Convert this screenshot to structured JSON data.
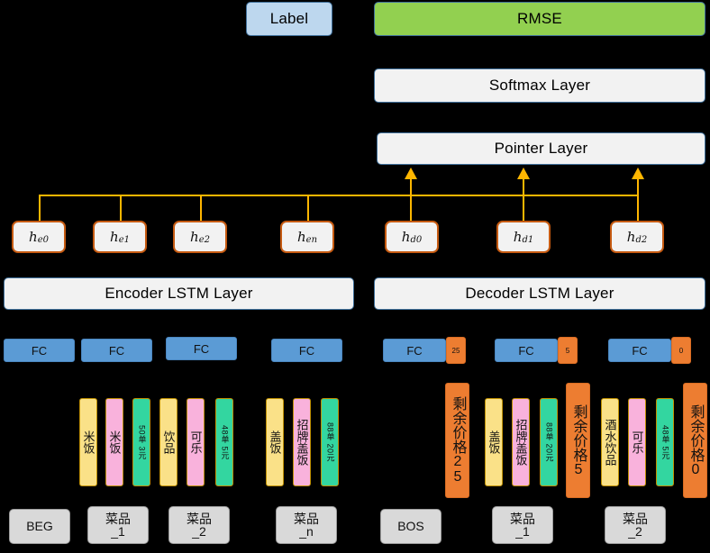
{
  "diagram": {
    "title_boxes": {
      "label": "Label",
      "rmse": "RMSE",
      "softmax": "Softmax Layer",
      "pointer": "Pointer Layer",
      "encoder_lstm": "Encoder LSTM Layer",
      "decoder_lstm": "Decoder LSTM Layer"
    },
    "colors": {
      "rmse_green": "#92D050",
      "label_blue": "#BDD7EE",
      "layer_gray": "#F2F2F2",
      "layer_border": "#41719C",
      "hidden_border": "#C55A11",
      "fc_blue": "#5B9BD5",
      "badge_orange": "#ED7D31",
      "chip_yellow": "#FAE188",
      "chip_pink": "#F9B2DC",
      "chip_green": "#33D6A0",
      "connector_orange": "#FFB600",
      "token_gray": "#D9D9D9",
      "background": "#000000"
    },
    "hidden_states": [
      {
        "base": "h",
        "sub": "e0"
      },
      {
        "base": "h",
        "sub": "e1"
      },
      {
        "base": "h",
        "sub": "e2"
      },
      {
        "base": "h",
        "sub": "en"
      },
      {
        "base": "h",
        "sub": "d0"
      },
      {
        "base": "h",
        "sub": "d1"
      },
      {
        "base": "h",
        "sub": "d2"
      }
    ],
    "fc_layers": [
      {
        "label": "FC",
        "badge": null
      },
      {
        "label": "FC",
        "badge": null
      },
      {
        "label": "FC",
        "badge": null
      },
      {
        "label": "FC",
        "badge": null
      },
      {
        "label": "FC",
        "badge": "25"
      },
      {
        "label": "FC",
        "badge": "5"
      },
      {
        "label": "FC",
        "badge": "0"
      }
    ],
    "encoder_chips": [
      {
        "text": "米饭",
        "color": "yellow",
        "kind": "word"
      },
      {
        "text": "米饭",
        "color": "pink",
        "kind": "word"
      },
      {
        "text": "50单 3元",
        "color": "green",
        "kind": "num"
      },
      {
        "text": "饮品",
        "color": "yellow",
        "kind": "word"
      },
      {
        "text": "可乐",
        "color": "pink",
        "kind": "word"
      },
      {
        "text": "48单 5元",
        "color": "green",
        "kind": "num"
      },
      {
        "text": "盖饭",
        "color": "yellow",
        "kind": "word"
      },
      {
        "text": "招牌盖饭",
        "color": "pink",
        "kind": "word"
      },
      {
        "text": "88单 20元",
        "color": "green",
        "kind": "num"
      }
    ],
    "decoder_chips": [
      {
        "text": "剩余价格25",
        "color": "orange",
        "kind": "price"
      },
      {
        "text": "盖饭",
        "color": "yellow",
        "kind": "word"
      },
      {
        "text": "招牌盖饭",
        "color": "pink",
        "kind": "word"
      },
      {
        "text": "88单 20元",
        "color": "green",
        "kind": "num"
      },
      {
        "text": "剩余价格5",
        "color": "orange",
        "kind": "price"
      },
      {
        "text": "酒水饮品",
        "color": "yellow",
        "kind": "word"
      },
      {
        "text": "可乐",
        "color": "pink",
        "kind": "word"
      },
      {
        "text": "48单 5元",
        "color": "green",
        "kind": "num"
      },
      {
        "text": "剩余价格0",
        "color": "orange",
        "kind": "price"
      }
    ],
    "tokens": [
      "BEG",
      "菜品\n_1",
      "菜品\n_2",
      "菜品\n_n",
      "BOS",
      "菜品\n_1",
      "菜品\n_2"
    ]
  }
}
